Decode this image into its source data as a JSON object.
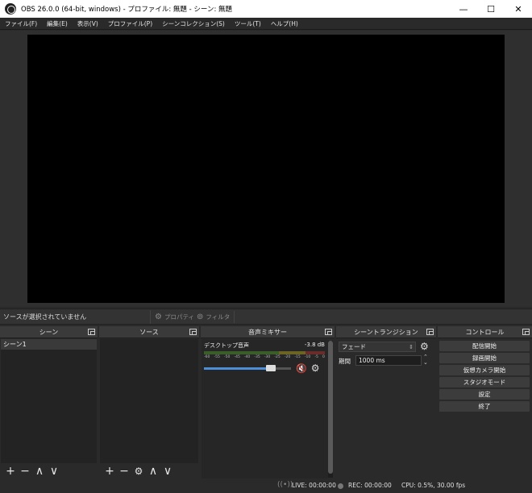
{
  "window": {
    "title": "OBS 26.0.0 (64-bit, windows) - プロファイル: 無題 - シーン: 無題",
    "minimize": "—",
    "maximize": "☐",
    "close": "✕"
  },
  "menu": [
    "ファイル(F)",
    "編集(E)",
    "表示(V)",
    "プロファイル(P)",
    "シーンコレクション(S)",
    "ツール(T)",
    "ヘルプ(H)"
  ],
  "sourcebar": {
    "no_selection": "ソースが選択されていません",
    "properties": "プロパティ",
    "filters": "フィルタ"
  },
  "scenes": {
    "title": "シーン",
    "items": [
      "シーン1"
    ]
  },
  "sources": {
    "title": "ソース"
  },
  "mixer": {
    "title": "音声ミキサー",
    "track_name": "デスクトップ音声",
    "track_level": "-3.8 dB",
    "scale": [
      "-60",
      "-55",
      "-50",
      "-45",
      "-40",
      "-35",
      "-30",
      "-25",
      "-20",
      "-15",
      "-10",
      "-5",
      "0"
    ],
    "fader_value": 0.8
  },
  "transitions": {
    "title": "シーントランジション",
    "selected": "フェード",
    "duration_label": "期間",
    "duration_value": "1000 ms"
  },
  "controls": {
    "title": "コントロール",
    "buttons": [
      "配信開始",
      "録画開始",
      "仮想カメラ開始",
      "スタジオモード",
      "設定",
      "終了"
    ]
  },
  "status": {
    "live": "LIVE: 00:00:00",
    "rec": "REC: 00:00:00",
    "cpu": "CPU: 0.5%, 30.00 fps"
  },
  "toolbar_glyphs": {
    "add": "+",
    "remove": "−",
    "up": "∧",
    "down": "∨",
    "gear": "⚙"
  }
}
